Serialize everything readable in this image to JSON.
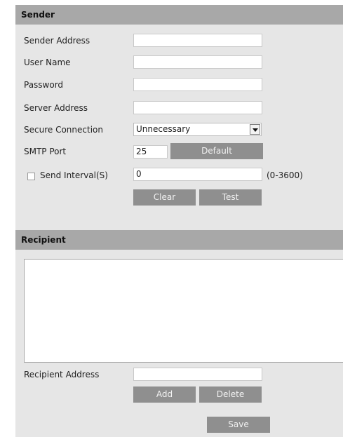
{
  "sender": {
    "title": "Sender",
    "sender_address": {
      "label": "Sender Address",
      "value": ""
    },
    "user_name": {
      "label": "User Name",
      "value": ""
    },
    "password": {
      "label": "Password",
      "value": ""
    },
    "server_address": {
      "label": "Server Address",
      "value": ""
    },
    "secure_connection": {
      "label": "Secure Connection",
      "selected": "Unnecessary"
    },
    "smtp_port": {
      "label": "SMTP Port",
      "value": "25",
      "default_button": "Default"
    },
    "send_interval": {
      "label": "Send Interval(S)",
      "checked": false,
      "value": "0",
      "range": "(0-3600)"
    },
    "clear_button": "Clear",
    "test_button": "Test"
  },
  "recipient": {
    "title": "Recipient",
    "list_items": [],
    "address": {
      "label": "Recipient Address",
      "value": ""
    },
    "add_button": "Add",
    "delete_button": "Delete"
  },
  "save_button": "Save"
}
